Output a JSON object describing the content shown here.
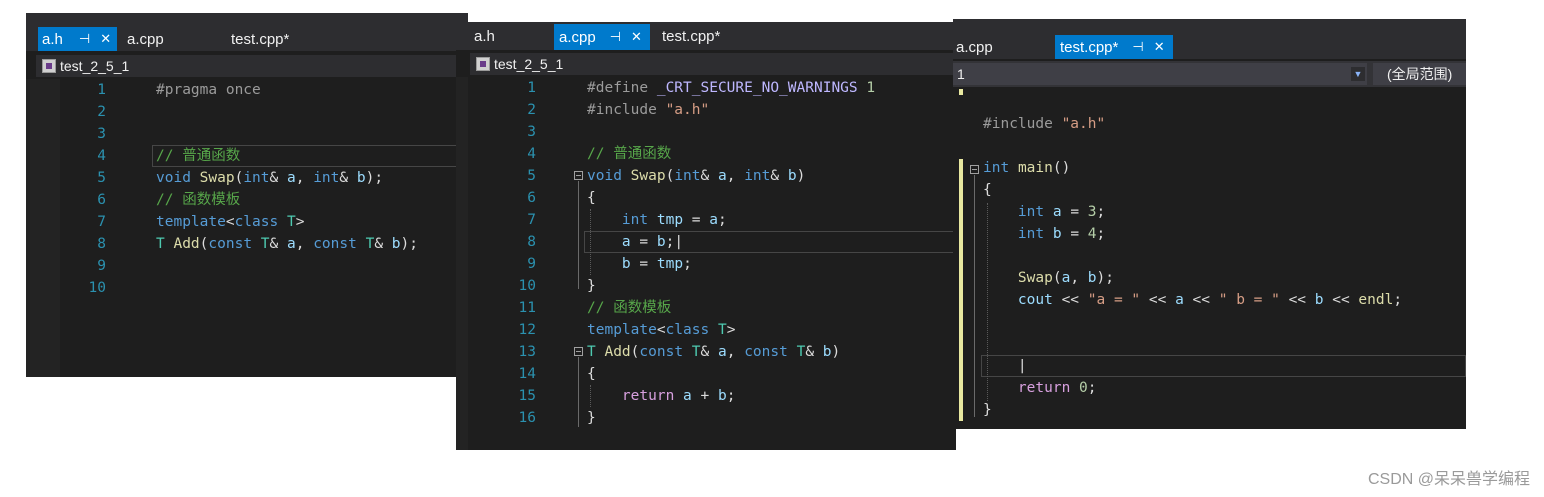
{
  "panel1": {
    "tabs": [
      "a.h",
      "a.cpp",
      "test.cpp*"
    ],
    "project": "test_2_5_1",
    "line_numbers": [
      "1",
      "2",
      "3",
      "4",
      "5",
      "6",
      "7",
      "8",
      "9",
      "10"
    ]
  },
  "panel2": {
    "tabs": [
      "a.h",
      "a.cpp",
      "test.cpp*"
    ],
    "project": "test_2_5_1",
    "line_numbers": [
      "1",
      "2",
      "3",
      "4",
      "5",
      "6",
      "7",
      "8",
      "9",
      "10",
      "11",
      "12",
      "13",
      "14",
      "15",
      "16"
    ]
  },
  "panel3": {
    "tabs": [
      "a.cpp",
      "test.cpp*"
    ],
    "nav_left": "1",
    "nav_right": "(全局范围)"
  },
  "icons": {
    "pin": "⊣",
    "close": "✕"
  },
  "watermark": "CSDN @呆呆兽学编程"
}
